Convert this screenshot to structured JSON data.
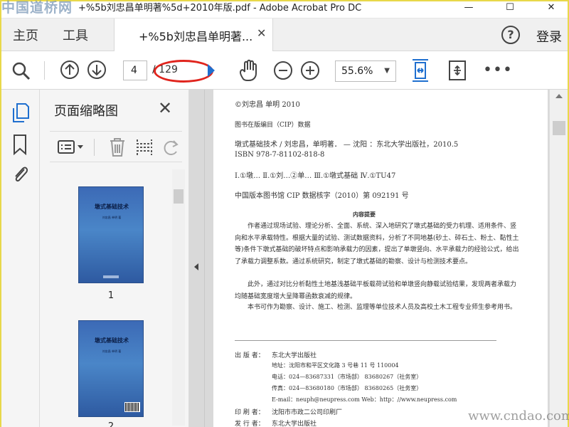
{
  "window": {
    "title": "+%5b刘忠昌单明著%5d+2010年版.pdf - Adobe Acrobat Pro DC",
    "minimize_glyph": "—",
    "maximize_glyph": "☐",
    "close_glyph": "✕"
  },
  "watermark_top": "中国道桥网",
  "watermark_bottom": "www.cndao.com",
  "menu": {
    "home": "主页",
    "tools": "工具",
    "doc_tab_label": "+%5b刘忠昌单明著...",
    "doc_tab_close": "✕",
    "help": "?",
    "login": "登录"
  },
  "toolbar": {
    "current_page": "4",
    "total_pages": "/ 129",
    "zoom": "55.6%",
    "zoom_caret": "▼",
    "more": "•••"
  },
  "thumb_panel": {
    "title": "页面缩略图",
    "close": "✕",
    "thumbnails": [
      {
        "number": "1",
        "cover_title": "墩式基础技术",
        "cover_author": "刘忠昌 单明 著"
      },
      {
        "number": "2",
        "cover_title": "墩式基础技术",
        "cover_author": "刘忠昌 单明 著"
      }
    ]
  },
  "pdf": {
    "copyright": "©刘忠昌    单明    2010",
    "cip_heading": "图书在版编目（CIP）数据",
    "cip_line": "墩式基础技术 / 刘忠昌，单明著． — 沈阳 ：东北大学出版社，2010.5",
    "isbn": "ISBN 978-7-81102-818-8",
    "class_line": "Ⅰ.①墩…    Ⅱ.①刘…②单…    Ⅲ.①墩式基础    Ⅳ.①TU47",
    "cip_number": "中国版本图书馆 CIP 数据核字（2010）第 092191 号",
    "abstract_title": "内容提要",
    "abstract_p1": "作者通过现场试验、理论分析、全面、系统、深入地研究了墩式基础的受力机理、适用条件、竖向和水平承载特性。根据大量的试验、测试数据资料，分析了不同地基(砂土、碎石土、粉土、黏性土等)条件下墩式基础的破坏特点和影响承载力的因素，提出了单墩竖向、水平承载力的经验公式，给出了承载力调整系数。通过系统研究，制定了墩式基础的勘察、设计与检测技术要点。",
    "abstract_p2": "此外，通过对比分析黏性土地基浅基础平板载荷试验和单墩竖向静载试验结果，发现两者承载力均随基础宽度增大呈降幂函数衰减的规律。",
    "abstract_p3": "本书可作为勘察、设计、施工、检测、监理等单位技术人员及高校土木工程专业师生参考用书。",
    "publisher_label": "出 版 者：",
    "publisher": "东北大学出版社",
    "address": "地址：沈阳市和平区文化路 3 号巷 11 号    110004",
    "phone": "电话：024—83687331（市场部）    83680267（社务室）",
    "fax": "传真：024—83680180（市场部）    83680265（社务室）",
    "email": "E-mail：neuph@neupress.com        Web：http：//www.neupress.com",
    "printer_label": "印 刷 者：",
    "printer": "沈阳市市政二公司印刷厂",
    "distributor_label": "发 行 者：",
    "distributor": "东北大学出版社"
  }
}
